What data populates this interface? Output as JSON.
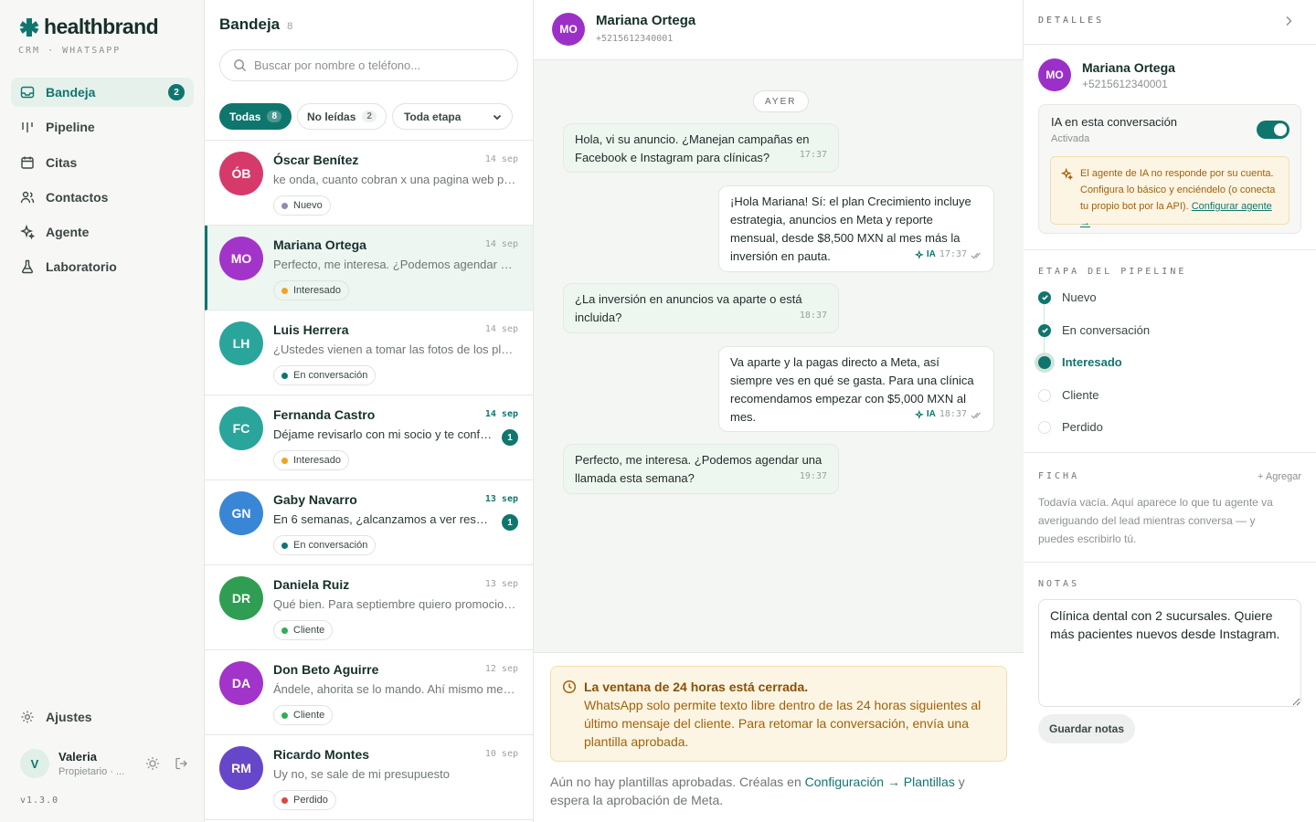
{
  "brand": {
    "name": "healthbrand",
    "subtitle": "CRM · WHATSAPP",
    "version": "v1.3.0"
  },
  "nav": [
    {
      "label": "Bandeja",
      "icon": "inbox-icon",
      "badge": "2",
      "active": true
    },
    {
      "label": "Pipeline",
      "icon": "pipeline-icon"
    },
    {
      "label": "Citas",
      "icon": "calendar-icon"
    },
    {
      "label": "Contactos",
      "icon": "users-icon"
    },
    {
      "label": "Agente",
      "icon": "sparkles-icon"
    },
    {
      "label": "Laboratorio",
      "icon": "flask-icon"
    }
  ],
  "settings_label": "Ajustes",
  "user": {
    "initial": "V",
    "name": "Valeria",
    "role": "Propietario · ..."
  },
  "inbox": {
    "title": "Bandeja",
    "count": "8",
    "search_placeholder": "Buscar por nombre o teléfono...",
    "filters": [
      {
        "label": "Todas",
        "count": "8",
        "active": true
      },
      {
        "label": "No leídas",
        "count": "2",
        "active": false
      }
    ],
    "stage_select": "Toda etapa",
    "conversations": [
      {
        "initials": "ÓB",
        "name": "Óscar Benítez",
        "date": "14 sep",
        "preview": "ke onda, cuanto cobran x una pagina web pa ...",
        "tag": "Nuevo",
        "tag_color": "#8b8fa8",
        "avatar_color": "#d63a6b",
        "unread": ""
      },
      {
        "initials": "MO",
        "name": "Mariana Ortega",
        "date": "14 sep",
        "preview": "Perfecto, me interesa. ¿Podemos agendar un...",
        "tag": "Interesado",
        "tag_color": "#f0a323",
        "avatar_color": "#a334c9",
        "unread": "",
        "selected": true
      },
      {
        "initials": "LH",
        "name": "Luis Herrera",
        "date": "14 sep",
        "preview": "¿Ustedes vienen a tomar las fotos de los platill...",
        "tag": "En conversación",
        "tag_color": "#0f766e",
        "avatar_color": "#2aa59b",
        "unread": ""
      },
      {
        "initials": "FC",
        "name": "Fernanda Castro",
        "date": "14 sep",
        "preview": "Déjame revisarlo con mi socio y te confir...",
        "tag": "Interesado",
        "tag_color": "#f0a323",
        "avatar_color": "#2aa59b",
        "unread": "1"
      },
      {
        "initials": "GN",
        "name": "Gaby Navarro",
        "date": "13 sep",
        "preview": "En 6 semanas, ¿alcanzamos a ver result...",
        "tag": "En conversación",
        "tag_color": "#0f766e",
        "avatar_color": "#3a86d6",
        "unread": "1"
      },
      {
        "initials": "DR",
        "name": "Daniela Ruiz",
        "date": "13 sep",
        "preview": "Qué bien. Para septiembre quiero promociona...",
        "tag": "Cliente",
        "tag_color": "#2fae55",
        "avatar_color": "#2f9e52",
        "unread": ""
      },
      {
        "initials": "DA",
        "name": "Don Beto Aguirre",
        "date": "12 sep",
        "preview": "Ándele, ahorita se lo mando. Ahí mismo me lo ...",
        "tag": "Cliente",
        "tag_color": "#2fae55",
        "avatar_color": "#a334c9",
        "unread": ""
      },
      {
        "initials": "RM",
        "name": "Ricardo Montes",
        "date": "10 sep",
        "preview": "Uy no, se sale de mi presupuesto",
        "tag": "Perdido",
        "tag_color": "#e0453e",
        "avatar_color": "#6747c9",
        "unread": ""
      }
    ]
  },
  "chat": {
    "initials": "MO",
    "name": "Mariana Ortega",
    "phone": "+5215612340001",
    "day": "AYER",
    "messages": [
      {
        "dir": "in",
        "text": "Hola, vi su anuncio. ¿Manejan campañas en Facebook e Instagram para clínicas?",
        "time": "17:37"
      },
      {
        "dir": "out",
        "text": "¡Hola Mariana! Sí: el plan Crecimiento incluye estrategia, anuncios en Meta y reporte mensual, desde $8,500 MXN al mes más la inversión en pauta.",
        "time": "17:37",
        "ia": "IA"
      },
      {
        "dir": "in",
        "text": "¿La inversión en anuncios va aparte o está incluida?",
        "time": "18:37"
      },
      {
        "dir": "out",
        "text": "Va aparte y la pagas directo a Meta, así siempre ves en qué se gasta. Para una clínica recomendamos empezar con $5,000 MXN al mes.",
        "time": "18:37",
        "ia": "IA"
      },
      {
        "dir": "in",
        "text": "Perfecto, me interesa. ¿Podemos agendar una llamada esta semana?",
        "time": "19:37"
      }
    ],
    "window_title": "La ventana de 24 horas está cerrada.",
    "window_text": "WhatsApp solo permite texto libre dentro de las 24 horas siguientes al último mensaje del cliente. Para retomar la conversación, envía una plantilla aprobada.",
    "foot_note_a": "Aún no hay plantillas aprobadas. Créalas en ",
    "foot_note_link": "Configuración → Plantillas",
    "foot_note_b": " y espera la aprobación de Meta."
  },
  "details": {
    "title": "DETALLES",
    "initials": "MO",
    "name": "Mariana Ortega",
    "phone": "+5215612340001",
    "ia_title": "IA en esta conversación",
    "ia_status": "Activada",
    "ia_enabled": true,
    "ia_warning": "El agente de IA no responde por su cuenta. Configura lo básico y enciéndelo (o conecta tu propio bot por la API). ",
    "ia_link": "Configurar agente →",
    "pipeline_title": "ETAPA DEL PIPELINE",
    "stages": [
      {
        "label": "Nuevo",
        "state": "done"
      },
      {
        "label": "En conversación",
        "state": "done"
      },
      {
        "label": "Interesado",
        "state": "current"
      },
      {
        "label": "Cliente",
        "state": "todo"
      },
      {
        "label": "Perdido",
        "state": "todo"
      }
    ],
    "ficha_title": "FICHA",
    "ficha_add": "+ Agregar",
    "ficha_text": "Todavía vacía. Aquí aparece lo que tu agente va averiguando del lead mientras conversa — y puedes escribirlo tú.",
    "notes_title": "NOTAS",
    "notes_value": "Clínica dental con 2 sucursales. Quiere más pacientes nuevos desde Instagram.",
    "save_notes": "Guardar notas"
  },
  "colors": {
    "accent": "#0f766e",
    "warning_bg": "#fdf5e4",
    "warning_text": "#a26108"
  }
}
